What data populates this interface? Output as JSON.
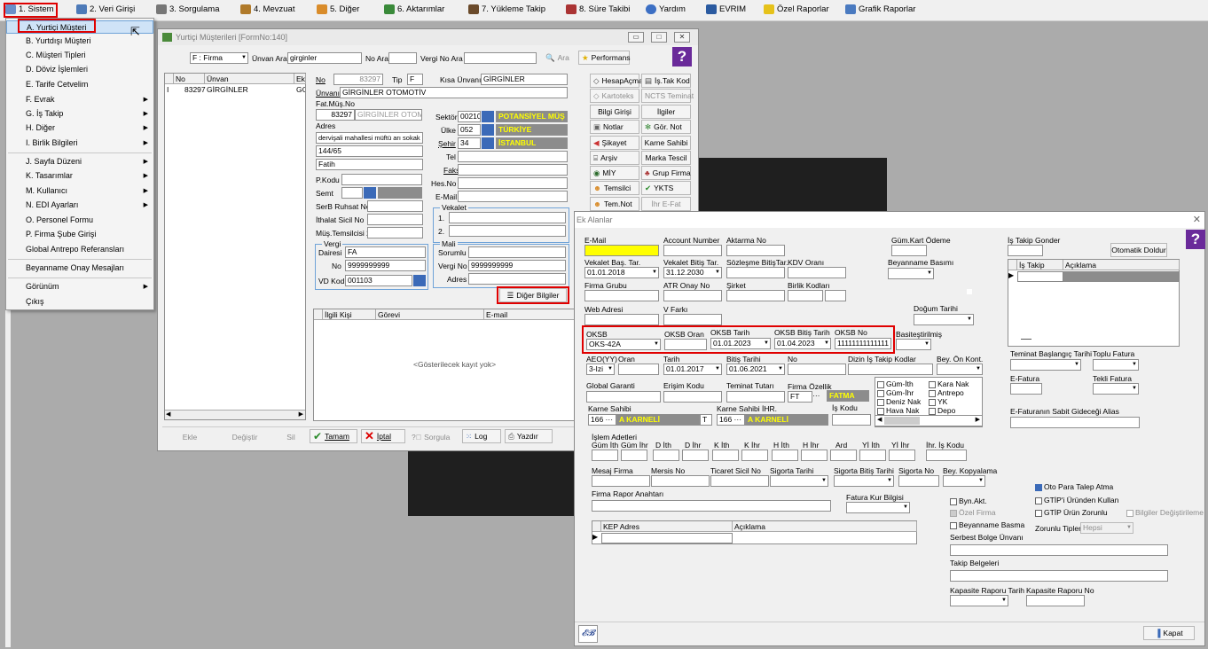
{
  "menubar": {
    "items": [
      {
        "label": "1. Sistem",
        "icon": "system-icon"
      },
      {
        "label": "2. Veri Girişi",
        "icon": "edit-icon"
      },
      {
        "label": "3. Sorgulama",
        "icon": "camera-icon"
      },
      {
        "label": "4. Mevzuat",
        "icon": "books-icon"
      },
      {
        "label": "5. Diğer",
        "icon": "people-icon"
      },
      {
        "label": "6. Aktarımlar",
        "icon": "transfer-icon"
      },
      {
        "label": "7. Yükleme Takip",
        "icon": "truck-icon"
      },
      {
        "label": "8. Süre Takibi",
        "icon": "calendar-icon"
      },
      {
        "label": "Yardım",
        "icon": "help-icon"
      },
      {
        "label": "EVRIM",
        "icon": "evrim-icon"
      },
      {
        "label": "Özel Raporlar",
        "icon": "star-icon"
      },
      {
        "label": "Grafik Raporlar",
        "icon": "chart-icon"
      }
    ]
  },
  "sistem_menu": {
    "items": [
      "A.  Yurtiçi Müşteri",
      "B.  Yurtdışı Müşteri",
      "C.  Müşteri Tipleri",
      "D.  Döviz İşlemleri",
      "E.  Tarife Cetvelim",
      "F.  Evrak",
      "G.  İş Takip",
      "H.  Diğer",
      "I.  Birlik Bilgileri",
      "J.  Sayfa Düzeni",
      "K.  Tasarımlar",
      "M.  Kullanıcı",
      "N.  EDI Ayarları",
      "O.  Personel Formu",
      "P.   Firma Şube Girişi",
      "Global Antrepo Referansları",
      "Beyanname Onay Mesajları",
      "Görünüm",
      "Çıkış"
    ],
    "selected": "A.  Yurtiçi Müşteri"
  },
  "customer_window": {
    "title": "Yurtiçi Müşterileri [FormNo:140]",
    "filter_type": "F : Firma",
    "unvan_ara_label": "Ünvan Ara",
    "unvan_ara_value": "girginler",
    "no_ara_label": "No Ara",
    "vergi_no_ara_label": "Vergi No Ara",
    "ara_button": "Ara",
    "performans_button": "Performans",
    "list_headers": [
      "No",
      "Ünvan",
      "Ek"
    ],
    "list_row": {
      "no": "83297",
      "unvan": "GİRGİNLER",
      "ek": "GG"
    },
    "no_label": "No",
    "no_value": "83297",
    "tip_label": "Tip",
    "tip_value": "F",
    "kisa_unvan_label": "Kısa Ünvanı",
    "kisa_unvan_value": "GİRGİNLER",
    "unvan_label": "Ünvanı",
    "unvan_value": "GİRGİNLER OTOMOTİV",
    "fat_mus_no_label": "Fat.Müş.No",
    "fat_mus_no_value": "83297",
    "fat_mus_name": "GİRGİNLER OTOMO",
    "adres_label": "Adres",
    "adres_lines": [
      "dervişali mahallesi müftü arı sokak",
      "144/65",
      "Fatih"
    ],
    "sektor_label": "Sektör",
    "sektor_code": "00210",
    "sektor_name": "POTANSİYEL MÜŞ",
    "ulke_label": "Ülke",
    "ulke_code": "052",
    "ulke_name": "TÜRKİYE",
    "sehir_label": "Şehir",
    "sehir_code": "34",
    "sehir_name": "İSTANBUL",
    "tel_label": "Tel",
    "faks_label": "Faks",
    "pkodu_label": "P.Kodu",
    "hesno_label": "Hes.No",
    "semt_label": "Semt",
    "email_label": "E-Mail",
    "serb_label": "SerB Ruhsat No",
    "ithalat_label": "İthalat Sicil No",
    "mus_temsil_label": "Müş.Temsilcisi 2",
    "vekalet_label": "Vekalet",
    "vekalet_rows": [
      "1.",
      "2."
    ],
    "vergi_label": "Vergi",
    "dairesi_label": "Dairesi",
    "dairesi_value": "FA",
    "vergi_no_label": "No",
    "vergi_no_value": "9999999999",
    "vd_kod_label": "VD Kod",
    "vd_kod_value": "001103",
    "mali_label": "Mali",
    "sorumlu_label": "Sorumlu",
    "mali_vergi_no_label": "Vergi No",
    "mali_vergi_no_value": "9999999999",
    "mali_adres_label": "Adres",
    "side_buttons": [
      [
        "HesapAçma",
        "İş.Tak Kod"
      ],
      [
        "Kartoteks",
        "NCTS Teminat"
      ],
      [
        "Bilgi Girişi",
        "İlgiler"
      ],
      [
        "Notlar",
        "Gör. Not"
      ],
      [
        "Şikayet",
        "Karne Sahibi"
      ],
      [
        "Arşiv",
        "Marka Tescil"
      ],
      [
        "MİY",
        "Grup Firma"
      ],
      [
        "Temsilci",
        "YKTS"
      ],
      [
        "Tem.Not",
        "İhr E-Fat"
      ]
    ],
    "diger_bilgiler_button": "Diğer Bilgiler",
    "contacts_headers": [
      "İlgili Kişi",
      "Görevi",
      "E-mail"
    ],
    "contacts_empty": "<Gösterilecek kayıt yok>",
    "bottom_buttons": [
      "Ekle",
      "Değiştir",
      "Sil",
      "Tamam",
      "İptal",
      "Sorgula",
      "Log",
      "Yazdır"
    ]
  },
  "ek_alanlar": {
    "title": "Ek Alanlar",
    "email_label": "E-Mail",
    "account_number_label": "Account Number",
    "aktarma_no_label": "Aktarma No",
    "gum_kart_label": "Güm.Kart Ödeme",
    "is_takip_gonder_label": "İş Takip Gonder",
    "otomatik_doldur_button": "Otomatik Doldur",
    "vekalet_bas_label": "Vekalet Baş. Tar.",
    "vekalet_bas_value": "01.01.2018",
    "vekalet_bit_label": "Vekalet Bitiş Tar.",
    "vekalet_bit_value": "31.12.2030",
    "sozlesme_label": "Sözleşme BitişTar.",
    "kdv_label": "KDV Oranı",
    "beyanname_basimi_label": "Beyanname Basımı",
    "is_takip_headers": [
      "İş Takip Kodu",
      "Açıklama"
    ],
    "firma_grubu_label": "Firma Grubu",
    "atr_label": "ATR Onay No",
    "sirket_label": "Şirket",
    "birlik_label": "Birlik Kodları",
    "web_label": "Web Adresi",
    "v_farki_label": "V Farkı",
    "dogum_label": "Doğum Tarihi",
    "oksb_label": "OKSB",
    "oksb_value": "OKS-42A",
    "oksb_oran_label": "OKSB Oran",
    "oksb_tarih_label": "OKSB Tarih",
    "oksb_tarih_value": "01.01.2023",
    "oksb_bitis_label": "OKSB Bitiş Tarih",
    "oksb_bitis_value": "01.04.2023",
    "oksb_no_label": "OKSB No",
    "oksb_no_value": "11111111111111",
    "basitestirilmis_label": "Basiteştirilmiş",
    "teminat_bas_label": "Teminat Başlangıç Tarihi",
    "toplu_fatura_label": "Toplu Fatura",
    "aeo_label": "AEO(YY)",
    "aeo_value": "3-Izi",
    "oran_label": "Oran",
    "tarih_label": "Tarih",
    "tarih_value": "01.01.2017",
    "bitis_label": "Bitiş Tarihi",
    "bitis_value": "01.06.2021",
    "aeo_no_label": "No",
    "dizin_label": "Dizin İş Takip Kodlar",
    "bey_on_kont_label": "Bey. Ön Kont.",
    "efatura_label": "E-Fatura",
    "tekli_fatura_label": "Tekli Fatura",
    "global_garanti_label": "Global Garanti",
    "erisim_label": "Erişim Kodu",
    "teminat_tutari_label": "Teminat Tutarı",
    "firma_ozellik_label": "Firma Özellik",
    "firma_ozellik_code": "FT",
    "firma_ozellik_name": "FATMA",
    "checks": [
      "Güm-İth",
      "Kara Nak",
      "Güm-İhr",
      "Antrepo",
      "Deniz Nak",
      "YK",
      "Hava Nak",
      "Depo"
    ],
    "karne_sahibi_label": "Karne Sahibi",
    "karne_code": "166",
    "karne_name": "A KARNELİ",
    "karne_t": "T",
    "karne_ihr_label": "Karne Sahibi İHR.",
    "karne_ihr_code": "166",
    "karne_ihr_name": "A KARNELİ",
    "is_kodu_label": "İş Kodu",
    "efatura_alias_label": "E-Faturanın Sabit Gideceği Alias",
    "islem_adetleri_label": "İşlem Adetleri",
    "islem_cols": [
      "Güm İth",
      "Güm İhr",
      "D İth",
      "D İhr",
      "K İth",
      "K İhr",
      "H İth",
      "H İhr",
      "Ard",
      "Yİ İth",
      "Yİ İhr",
      "İhr. İş Kodu"
    ],
    "mesaj_firma_label": "Mesaj Firma",
    "mersis_label": "Mersis No",
    "ticaret_label": "Ticaret Sicil No",
    "sigorta_tarihi_label": "Sigorta Tarihi",
    "sigorta_bitis_label": "Sigorta Bitiş Tarihi",
    "sigorta_no_label": "Sigorta No",
    "bey_kopyalama_label": "Bey. Kopyalama",
    "oto_para_label": "Oto Para Talep Atma",
    "gtip_urun_label": "GTİP'i Üründen Kullan",
    "gtip_zorunlu_label": "GTİP Ürün Zorunlu",
    "bilgiler_degis_label": "Bilgiler Değiştirileme",
    "firma_rapor_label": "Firma Rapor Anahtarı",
    "fatura_kur_label": "Fatura Kur Bilgisi",
    "byn_akt_label": "Byn.Akt.",
    "ozel_firma_label": "Özel Firma",
    "bey_basma_label": "Beyanname Basma",
    "zorunlu_tipler_label": "Zorunlu Tipler",
    "zorunlu_tipler_value": "Hepsi",
    "serbest_bolge_label": "Serbest Bolge Ünvanı",
    "kep_headers": [
      "KEP Adres",
      "Açıklama"
    ],
    "takip_belgeleri_label": "Takip Belgeleri",
    "kapasite_tarih_label": "Kapasite Raporu Tarih",
    "kapasite_no_label": "Kapasite Raporu No",
    "kapat_button": "Kapat"
  }
}
